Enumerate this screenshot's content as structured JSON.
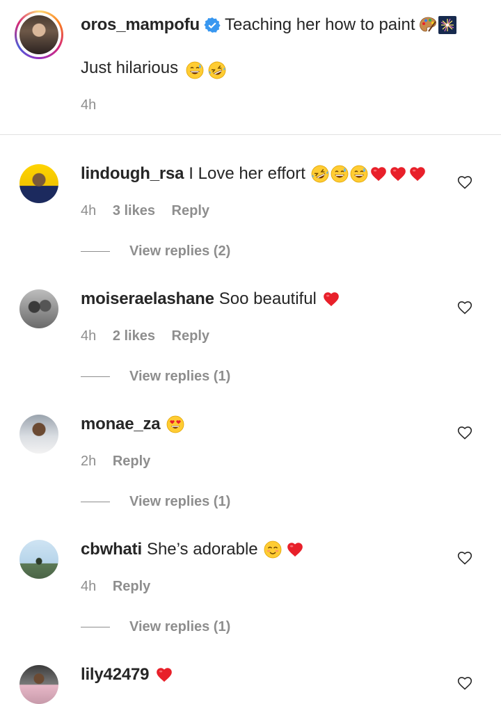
{
  "caption": {
    "username": "oros_mampofu",
    "line1": "Teaching her how to paint",
    "line1_emojis": [
      "palette-emoji",
      "fireworks-emoji"
    ],
    "line2": "Just hilarious",
    "line2_emojis": [
      "grinning-sweat-emoji",
      "rofl-emoji"
    ],
    "time": "4h"
  },
  "comments": [
    {
      "username": "lindough_rsa",
      "text": "I Love her effort",
      "emojis": [
        "rofl-emoji",
        "grinning-sweat-emoji",
        "grinning-sweat-emoji",
        "red-heart-emoji",
        "red-heart-emoji",
        "red-heart-emoji"
      ],
      "time": "4h",
      "likes": "3 likes",
      "reply": "Reply",
      "view_replies": "View replies (2)"
    },
    {
      "username": "moiseraelashane",
      "text": "Soo beautiful",
      "emojis": [
        "red-heart-emoji"
      ],
      "time": "4h",
      "likes": "2 likes",
      "reply": "Reply",
      "view_replies": "View replies (1)"
    },
    {
      "username": "monae_za",
      "text": "",
      "emojis": [
        "heart-eyes-emoji"
      ],
      "time": "2h",
      "likes": "",
      "reply": "Reply",
      "view_replies": "View replies (1)"
    },
    {
      "username": "cbwhati",
      "text": "She’s adorable",
      "emojis": [
        "blush-emoji",
        "red-heart-emoji"
      ],
      "time": "4h",
      "likes": "",
      "reply": "Reply",
      "view_replies": "View replies (1)"
    },
    {
      "username": "lily42479",
      "text": "",
      "emojis": [
        "red-heart-emoji"
      ]
    }
  ],
  "colors": {
    "muted": "#8e8e8e",
    "text": "#262626",
    "verified": "#3897f0",
    "heart": "#ed1c24"
  }
}
